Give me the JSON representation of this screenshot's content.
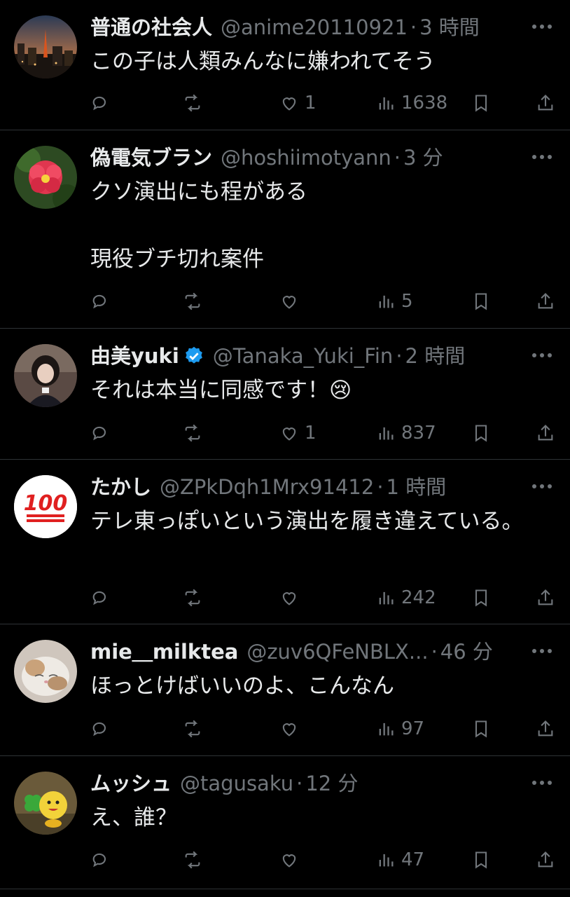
{
  "tweets": [
    {
      "name": "普通の社会人",
      "handle": "@anime20110921",
      "dot": "·",
      "time": "3 時間",
      "text": "この子は人類みんなに嫌われてそう",
      "likes": "1",
      "views": "1638",
      "verified": false,
      "avatar": "night-city-avatar"
    },
    {
      "name": "偽電気ブラン",
      "handle": "@hoshiimotyann",
      "dot": "·",
      "time": "3 分",
      "text": "クソ演出にも程がある\n\n現役ブチ切れ案件",
      "likes": "",
      "views": "5",
      "verified": false,
      "avatar": "red-flower-avatar"
    },
    {
      "name": "由美yuki",
      "handle": "@Tanaka_Yuki_Fin",
      "dot": "·",
      "time": "2 時間",
      "text": "それは本当に同感です！😢",
      "likes": "1",
      "views": "837",
      "verified": true,
      "avatar": "girl-photo-avatar"
    },
    {
      "name": "たかし",
      "handle": "@ZPkDqh1Mrx91412",
      "dot": "·",
      "time": "1 時間",
      "text": "テレ東っぽいという演出を履き違えている。",
      "likes": "",
      "views": "242",
      "verified": false,
      "avatar": "hundred-emoji-avatar"
    },
    {
      "name": "mie＿milktea",
      "handle": "@zuv6QFeNBLX...",
      "dot": "·",
      "time": "46 分",
      "text": "ほっとけばいいのよ、こんなん",
      "likes": "",
      "views": "97",
      "verified": false,
      "avatar": "cat-avatar"
    },
    {
      "name": "ムッシュ",
      "handle": "@tagusaku",
      "dot": "·",
      "time": "12 分",
      "text": "え、誰？",
      "likes": "",
      "views": "47",
      "verified": false,
      "avatar": "clover-character-avatar"
    }
  ],
  "colors": {
    "background": "#000000",
    "text": "#e7e9ea",
    "muted": "#71767b",
    "divider": "#2f3336",
    "verified": "#1d9bf0"
  }
}
